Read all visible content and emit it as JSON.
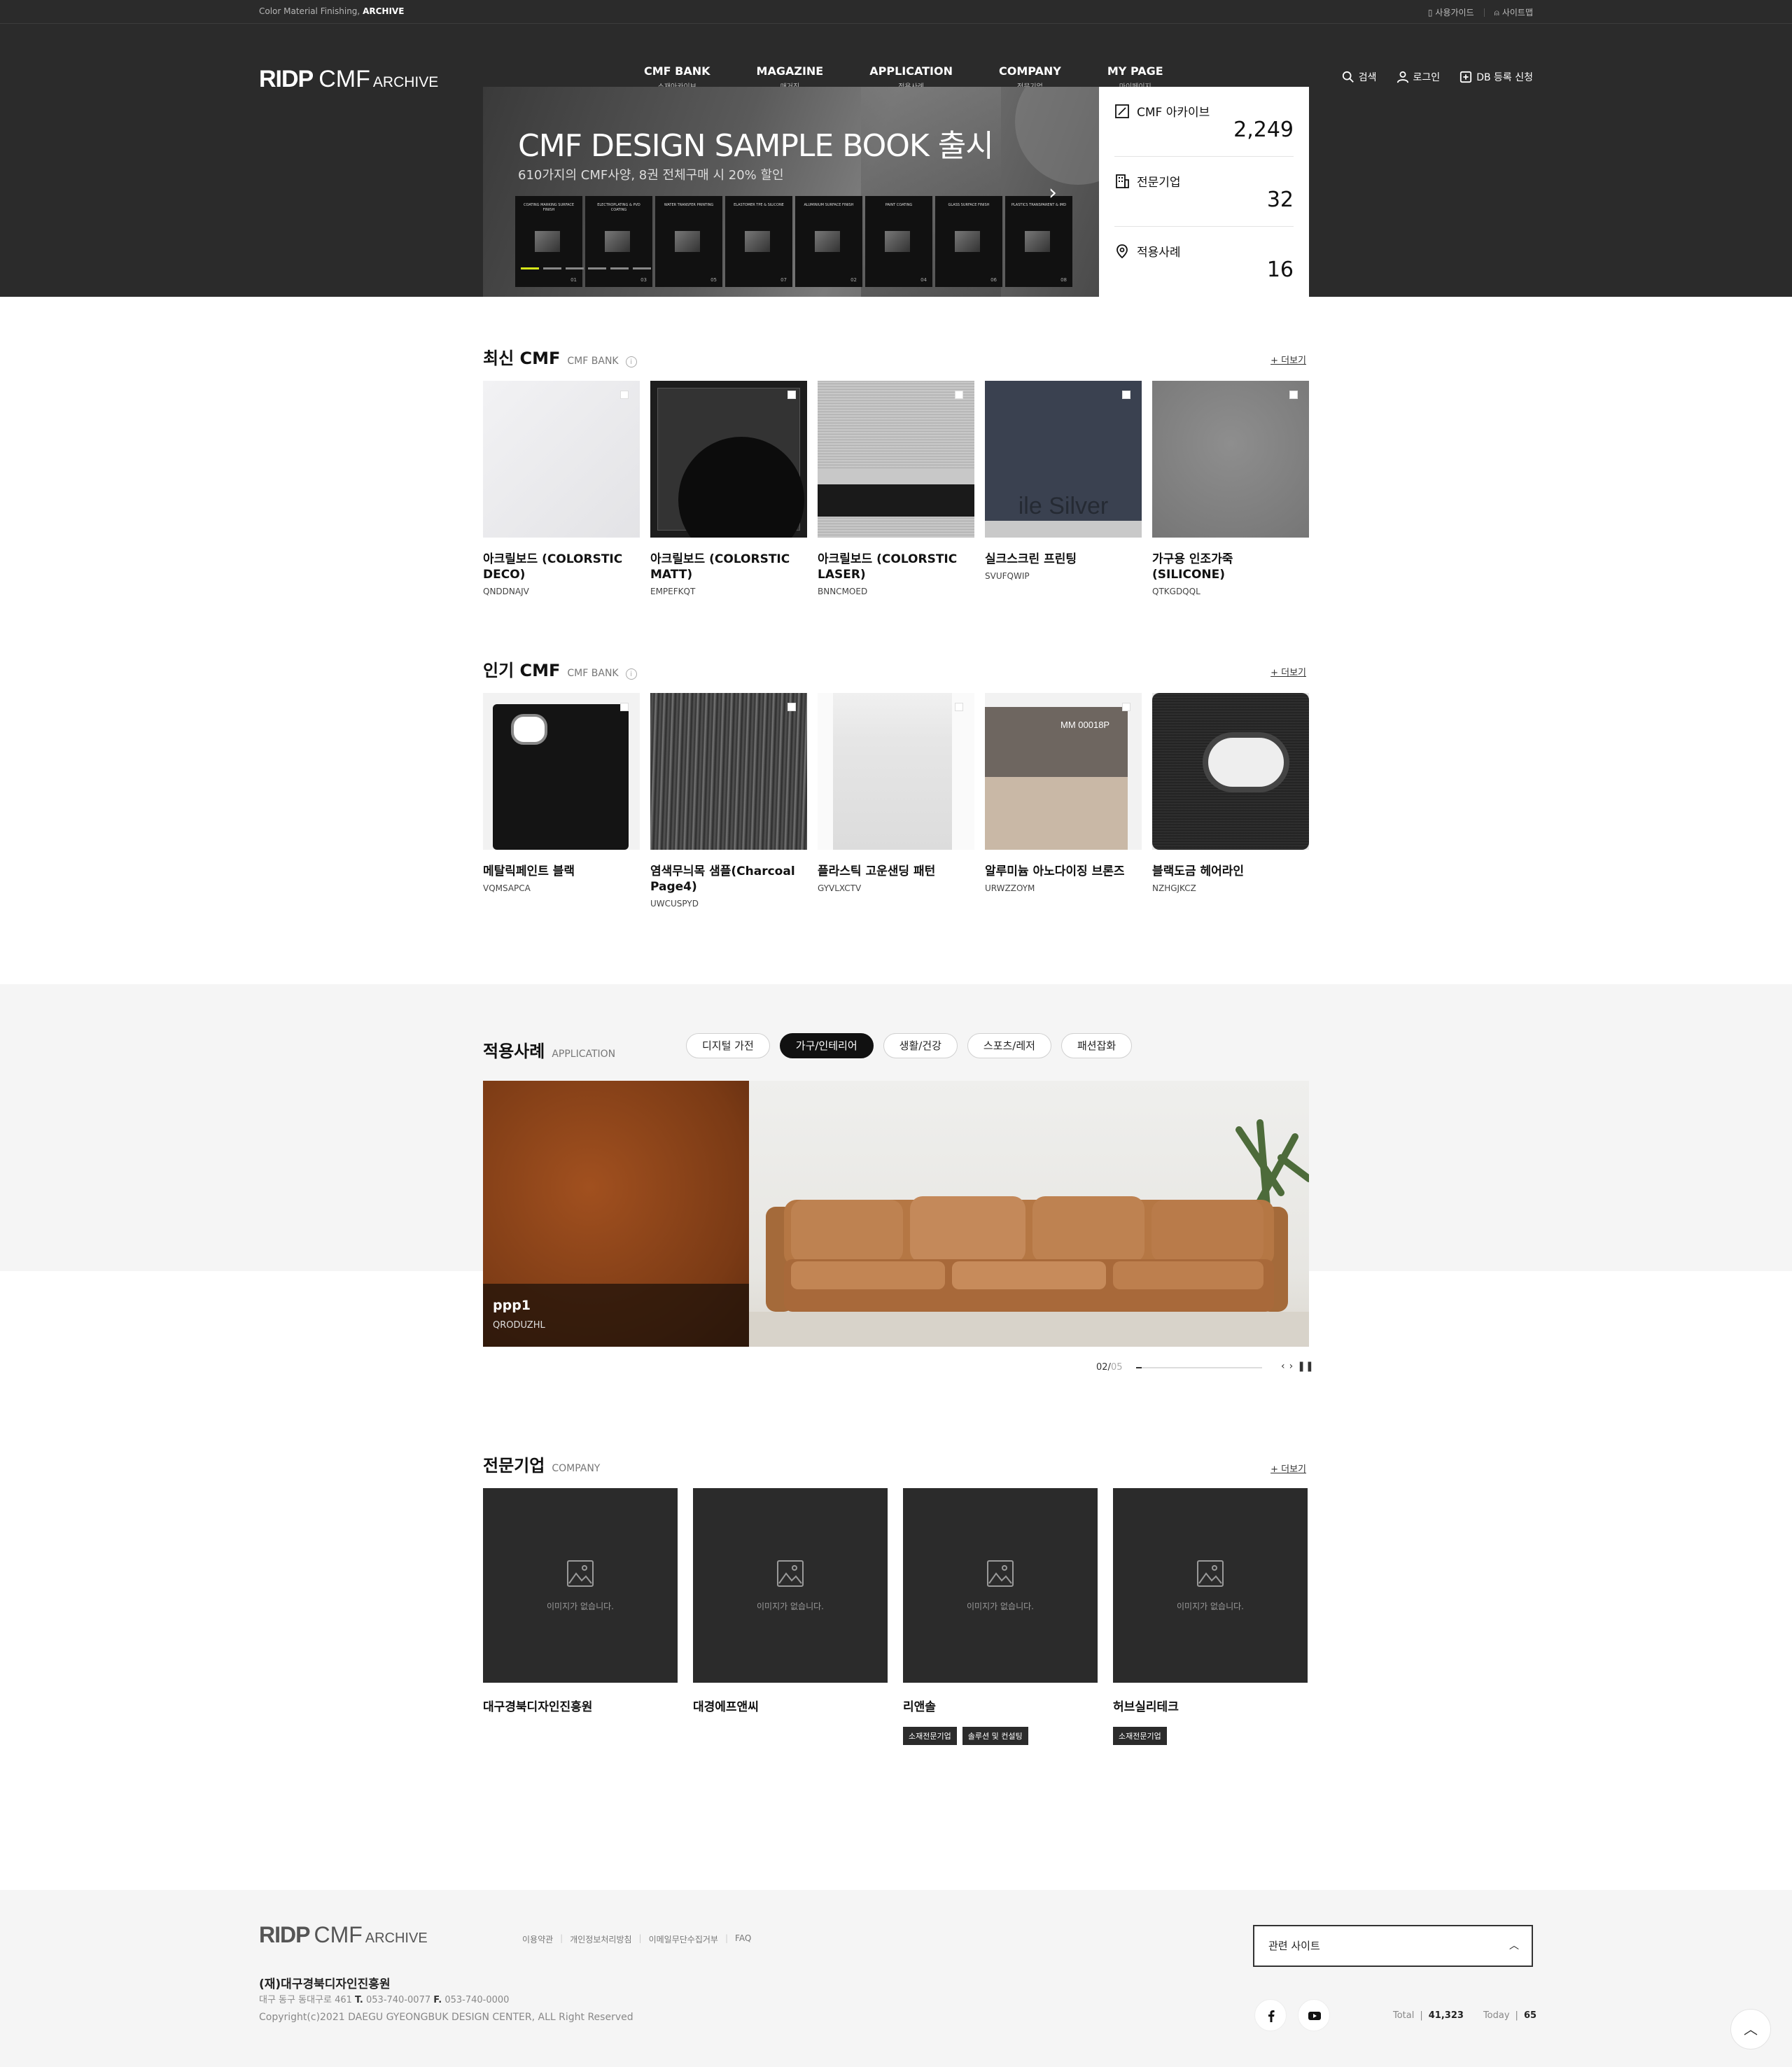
{
  "topbar": {
    "tagline_prefix": "Color Material Finishing,",
    "tagline_strong": "ARCHIVE",
    "guide": "사용가이드",
    "sitemap": "사이트맵"
  },
  "logo": {
    "a": "RIDP",
    "b": "CMF",
    "c": "ARCHIVE"
  },
  "nav": [
    {
      "label": "CMF BANK",
      "sub": "소재아카이브"
    },
    {
      "label": "MAGAZINE",
      "sub": "매거진"
    },
    {
      "label": "APPLICATION",
      "sub": "적용사례"
    },
    {
      "label": "COMPANY",
      "sub": "전문기업"
    },
    {
      "label": "MY PAGE",
      "sub": "마이페이지"
    }
  ],
  "header_util": {
    "search": "검색",
    "login": "로그인",
    "db_request": "DB 등록 신청"
  },
  "hero": {
    "title": "CMF DESIGN SAMPLE BOOK 출시",
    "subtitle": "610가지의 CMF사양, 8권 전체구매 시 20% 할인",
    "books": [
      {
        "title": "COATING MARKING SURFACE FINISH",
        "num": "01"
      },
      {
        "title": "ELECTROPLATING & PVD COATING",
        "num": "03"
      },
      {
        "title": "WATER TRANSFER PRINTING",
        "num": "05"
      },
      {
        "title": "ELASTOMER TPE & SILICONE",
        "num": "07"
      },
      {
        "title": "ALUMINIUM SURFACE FINISH",
        "num": "02"
      },
      {
        "title": "PAINT COATING",
        "num": "04"
      },
      {
        "title": "GLASS SURFACE FINISH",
        "num": "06"
      },
      {
        "title": "PLASTICS TRANSPARENT & IMD",
        "num": "08"
      }
    ]
  },
  "stats": [
    {
      "label": "CMF 아카이브",
      "value": "2,249"
    },
    {
      "label": "전문기업",
      "value": "32"
    },
    {
      "label": "적용사례",
      "value": "16"
    }
  ],
  "latest": {
    "title": "최신 CMF",
    "eng": "CMF BANK",
    "more": "+ 더보기",
    "items": [
      {
        "title": "아크릴보드 (COLORSTIC DECO)",
        "code": "QNDDNAJV"
      },
      {
        "title": "아크릴보드 (COLORSTIC MATT)",
        "code": "EMPEFKQT"
      },
      {
        "title": "아크릴보드 (COLORSTIC LASER)",
        "code": "BNNCMOED"
      },
      {
        "title": "실크스크린 프린팅",
        "code": "SVUFQWIP",
        "emboss": "ile Silver"
      },
      {
        "title": "가구용 인조가죽 (SILICONE)",
        "code": "QTKGDQQL"
      }
    ]
  },
  "popular": {
    "title": "인기 CMF",
    "eng": "CMF BANK",
    "more": "+ 더보기",
    "items": [
      {
        "title": "메탈릭페인트 블랙",
        "code": "VQMSAPCA"
      },
      {
        "title": "염색무늬목 샘플(Charcoal Page4)",
        "code": "UWCUSPYD"
      },
      {
        "title": "플라스틱 고운샌딩 패턴",
        "code": "GYVLXCTV"
      },
      {
        "title": "알루미늄 아노다이징 브론즈",
        "code": "URWZZOYM",
        "label": "MM 00018P"
      },
      {
        "title": "블랙도금 헤어라인",
        "code": "NZHGJKCZ"
      }
    ]
  },
  "application": {
    "title": "적용사례",
    "eng": "APPLICATION",
    "tabs": [
      "디지털 가전",
      "가구/인테리어",
      "생활/건강",
      "스포츠/레저",
      "패션잡화"
    ],
    "active_tab": "가구/인테리어",
    "slide": {
      "name": "ppp1",
      "code": "QRODUZHL"
    },
    "pager": {
      "current": "02",
      "total": "05",
      "progress": 0.04
    }
  },
  "company": {
    "title": "전문기업",
    "eng": "COMPANY",
    "more": "+ 더보기",
    "no_image": "이미지가 없습니다.",
    "items": [
      {
        "name": "대구경북디자인진흥원",
        "badges": []
      },
      {
        "name": "대경에프앤씨",
        "badges": []
      },
      {
        "name": "리앤솔",
        "badges": [
          "소재전문기업",
          "솔루션 및 컨설팅"
        ]
      },
      {
        "name": "허브실리테크",
        "badges": [
          "소재전문기업"
        ]
      }
    ]
  },
  "footer": {
    "links": [
      "이용약관",
      "개인정보처리방침",
      "이메일무단수집거부",
      "FAQ"
    ],
    "org": "(재)대구경북디자인진흥원",
    "addr": "대구 동구 동대구로 461",
    "tel_label": "T.",
    "tel": "053-740-0077",
    "fax_label": "F.",
    "fax": "053-740-0000",
    "copyright": "Copyright(c)2021 DAEGU GYEONGBUK DESIGN CENTER, ALL Right Reserved",
    "related": "관련 사이트",
    "total_label": "Total",
    "total": "41,323",
    "today_label": "Today",
    "today": "65"
  }
}
